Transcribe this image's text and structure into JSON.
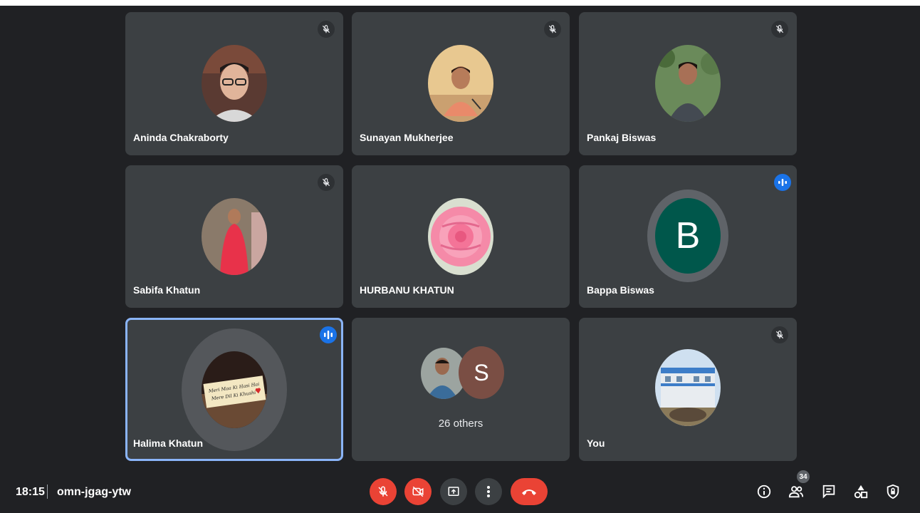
{
  "participants": [
    {
      "name": "Aninda Chakraborty",
      "status": "muted"
    },
    {
      "name": "Sunayan Mukherjee",
      "status": "muted"
    },
    {
      "name": "Pankaj Biswas",
      "status": "muted"
    },
    {
      "name": "Sabifa Khatun",
      "status": "muted"
    },
    {
      "name": "HURBANU KHATUN",
      "status": "none"
    },
    {
      "name": "Bappa Biswas",
      "status": "speaking",
      "avatar_letter": "B",
      "avatar_color": "#00574b"
    },
    {
      "name": "Halima Khatun",
      "status": "speaking"
    },
    {
      "others_label": "26 others",
      "avatar_letter": "S"
    },
    {
      "name": "You",
      "status": "muted"
    }
  ],
  "halima_photo_text": {
    "line1": "Meri Maa Ki Hasi Hai",
    "line2": "Mere Dil Ki Khushi"
  },
  "bottom_bar": {
    "time": "18:15",
    "meeting_code": "omn-jgag-ytw",
    "controls": [
      {
        "name": "mic-off",
        "icon": "mic-off-icon",
        "color": "#ea4335"
      },
      {
        "name": "camera-off",
        "icon": "videocam-off-icon",
        "color": "#ea4335"
      },
      {
        "name": "present",
        "icon": "present-screen-icon",
        "color": "#3c4043"
      },
      {
        "name": "more",
        "icon": "more-vert-icon",
        "color": "#3c4043"
      },
      {
        "name": "leave",
        "icon": "call-end-icon",
        "color": "#ea4335"
      }
    ],
    "right_icons": [
      "info-icon",
      "people-icon",
      "chat-icon",
      "activities-icon",
      "host-controls-icon"
    ],
    "people_count": "34"
  },
  "colors": {
    "background": "#202124",
    "tile": "#3c4043",
    "accent": "#8ab4f8",
    "speaking": "#1a73e8",
    "danger": "#ea4335"
  }
}
